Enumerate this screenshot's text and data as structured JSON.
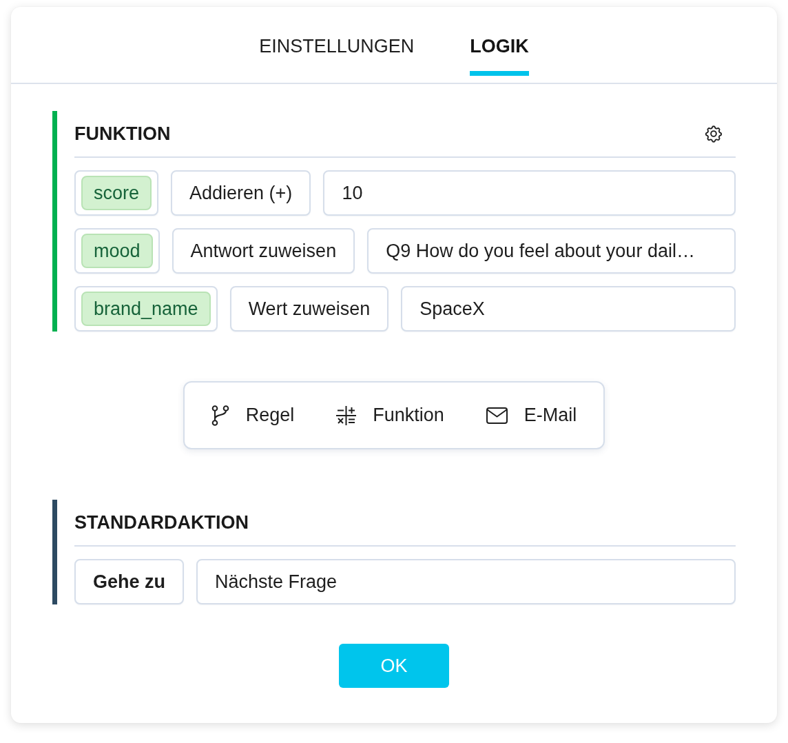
{
  "tabs": [
    {
      "label": "EINSTELLUNGEN",
      "selected": false
    },
    {
      "label": "LOGIK",
      "selected": true
    }
  ],
  "function_section": {
    "title": "FUNKTION",
    "rows": [
      {
        "variable": "score",
        "operation": "Addieren (+)",
        "value": "10"
      },
      {
        "variable": "mood",
        "operation": "Antwort zuweisen",
        "value": "Q9 How do you feel about your dail…"
      },
      {
        "variable": "brand_name",
        "operation": "Wert zuweisen",
        "value": "SpaceX"
      }
    ]
  },
  "action_bar": {
    "items": [
      {
        "kind": "rule",
        "label": "Regel"
      },
      {
        "kind": "function",
        "label": "Funktion"
      },
      {
        "kind": "email",
        "label": "E-Mail"
      }
    ]
  },
  "default_section": {
    "title": "STANDARDAKTION",
    "action": "Gehe zu",
    "target": "Nächste Frage"
  },
  "ok_button": {
    "label": "OK"
  }
}
